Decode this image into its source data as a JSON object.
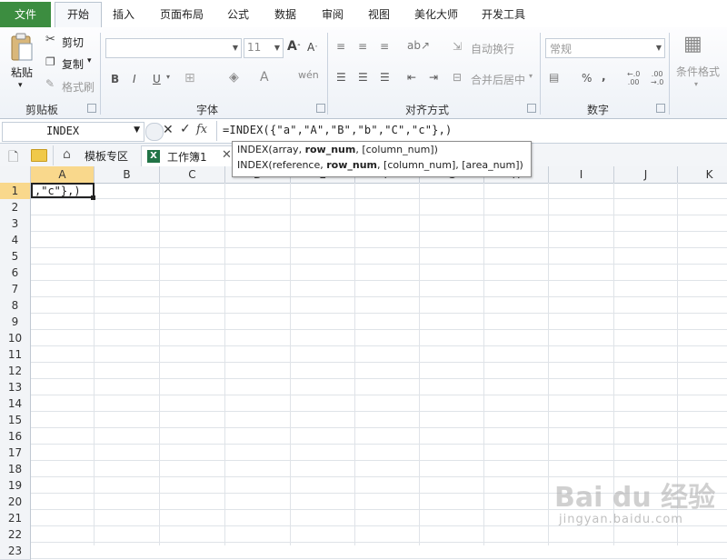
{
  "menu": {
    "file": "文件",
    "tabs": [
      "开始",
      "插入",
      "页面布局",
      "公式",
      "数据",
      "审阅",
      "视图",
      "美化大师",
      "开发工具"
    ],
    "active_index": 0
  },
  "ribbon": {
    "clipboard": {
      "paste": "粘贴",
      "cut": "剪切",
      "copy": "复制",
      "format_painter": "格式刷",
      "label": "剪贴板"
    },
    "font": {
      "size": "11",
      "bold": "B",
      "italic": "I",
      "underline": "U",
      "label": "字体"
    },
    "alignment": {
      "wrap_text": "自动换行",
      "merge_center": "合并后居中",
      "label": "对齐方式"
    },
    "number": {
      "format": "常规",
      "percent": "%",
      "comma": ",",
      "label": "数字"
    },
    "styles": {
      "conditional_format": "条件格式"
    }
  },
  "formula_bar": {
    "name_box": "INDEX",
    "fx": "fx",
    "formula": "=INDEX({\"a\",\"A\",\"B\",\"b\",\"C\",\"c\"},)"
  },
  "tooltip": {
    "line1_a": "INDEX(array, ",
    "line1_b": "row_num",
    "line1_c": ", [column_num])",
    "line2_a": "INDEX(reference, ",
    "line2_b": "row_num",
    "line2_c": ", [column_num], [area_num])"
  },
  "doc_tabs": {
    "template": "模板专区",
    "workbook": "工作簿1"
  },
  "grid": {
    "columns": [
      "A",
      "B",
      "C",
      "D",
      "E",
      "F",
      "G",
      "H",
      "I",
      "J",
      "K"
    ],
    "rows": [
      "1",
      "2",
      "3",
      "4",
      "5",
      "6",
      "7",
      "8",
      "9",
      "10",
      "11",
      "12",
      "13",
      "14",
      "15",
      "16",
      "17",
      "18",
      "19",
      "20",
      "21",
      "22",
      "23"
    ],
    "active_cell_text": ",\"c\"},)"
  },
  "watermark": {
    "brand": "Bai du 经验",
    "url": "jingyan.baidu.com"
  },
  "colors": {
    "file_tab": "#3c8d40",
    "selected_header": "#f9d88c"
  }
}
